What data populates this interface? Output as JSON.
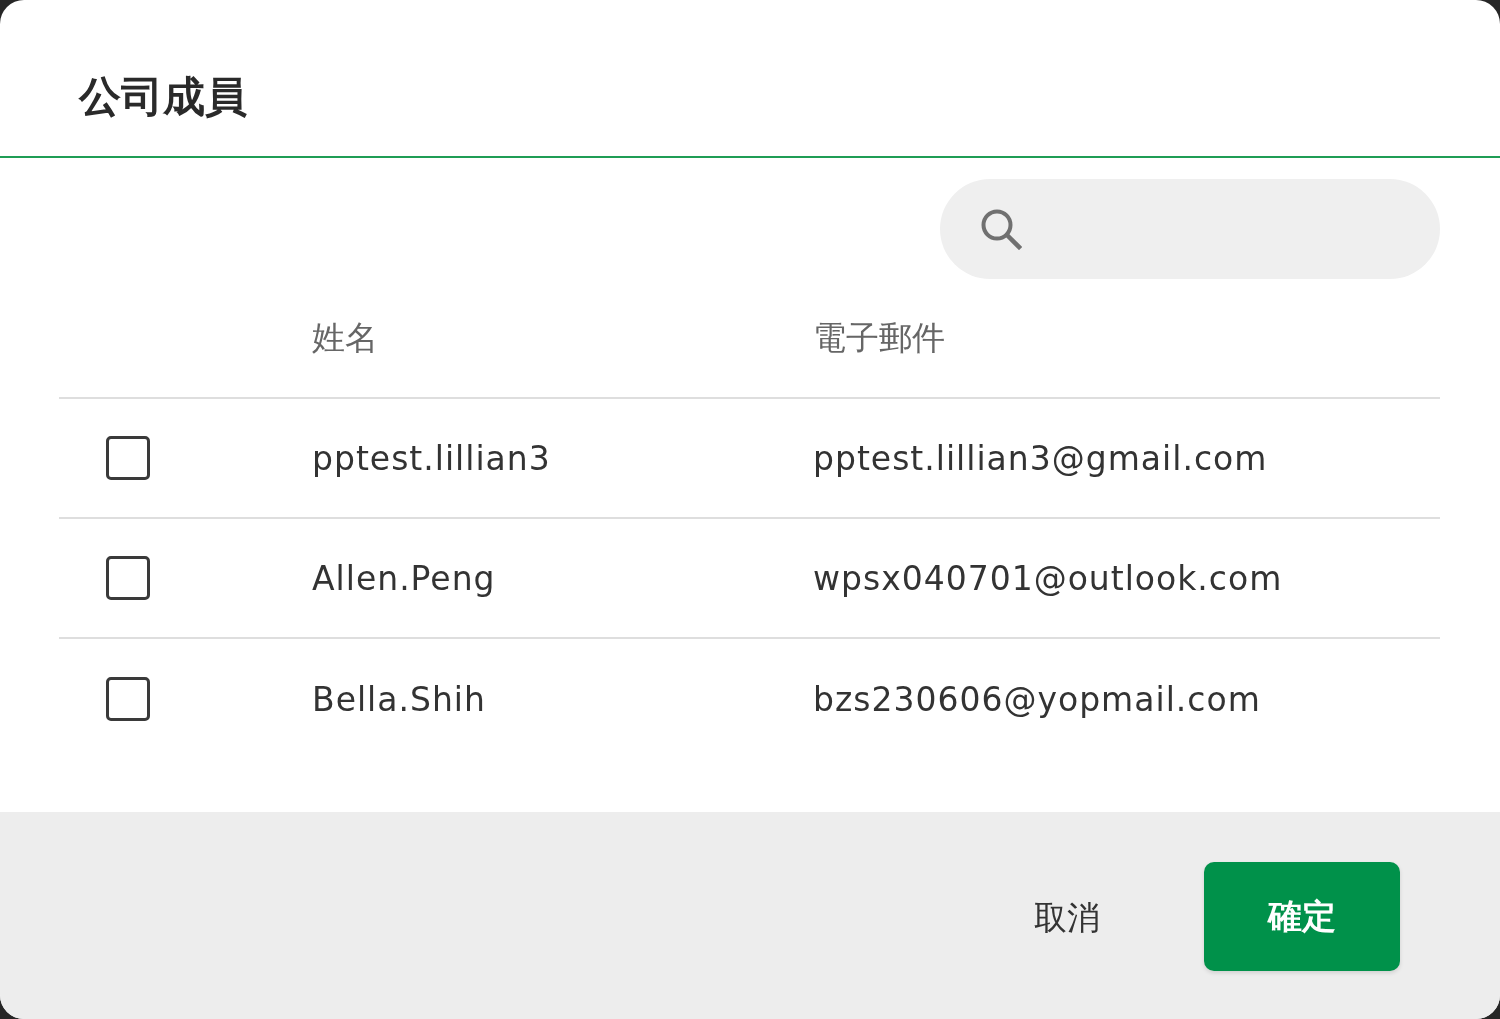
{
  "dialog": {
    "title": "公司成員"
  },
  "table": {
    "columns": [
      "姓名",
      "電子郵件"
    ],
    "rows": [
      {
        "checked": false,
        "name": "pptest.lillian3",
        "email": "pptest.lillian3@gmail.com"
      },
      {
        "checked": false,
        "name": "Allen.Peng",
        "email": "wpsx040701@outlook.com"
      },
      {
        "checked": false,
        "name": "Bella.Shih",
        "email": "bzs230606@yopmail.com"
      }
    ]
  },
  "footer": {
    "cancel": "取消",
    "confirm": "確定"
  }
}
